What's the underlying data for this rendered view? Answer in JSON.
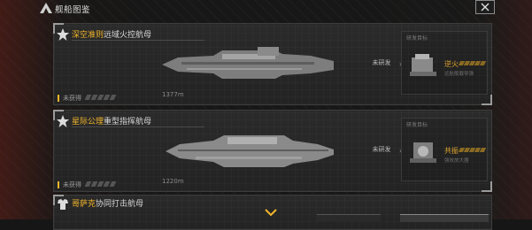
{
  "header": {
    "title": "舰船图鉴",
    "close_icon": "close-icon"
  },
  "ships": [
    {
      "name_highlight": "深空准则",
      "name_rest": "远域火控航母",
      "acquired_label": "未获得",
      "length": "1377m",
      "status": "未研发",
      "target_title": "研发目标",
      "target_name": "逆火",
      "target_sub": "远航舰载导弹"
    },
    {
      "name_highlight": "星际公理",
      "name_rest": "重型指挥航母",
      "acquired_label": "未获得",
      "length": "1220m",
      "status": "未研发",
      "target_title": "研发目标",
      "target_name": "共振",
      "target_sub": "强效放大器"
    },
    {
      "name_highlight": "哥萨克",
      "name_rest": "协同打击航母"
    }
  ],
  "colors": {
    "accent": "#f2b62a",
    "target": "#e0a530"
  }
}
